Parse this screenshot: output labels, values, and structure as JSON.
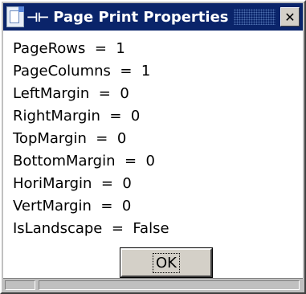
{
  "window": {
    "title": "Page Print Properties",
    "pin_glyph": "⊣⊢",
    "close_glyph": "✕"
  },
  "properties": [
    "PageRows  =  1",
    "PageColumns  =  1",
    "LeftMargin  =  0",
    "RightMargin  =  0",
    "TopMargin  =  0",
    "BottomMargin  =  0",
    "HoriMargin  =  0",
    "VertMargin  =  0",
    "IsLandscape  =  False"
  ],
  "ok_label": "OK",
  "colors": {
    "titlebar": "#0a246a",
    "content_bg": "#ffffff",
    "frame": "#c0c0c0"
  }
}
